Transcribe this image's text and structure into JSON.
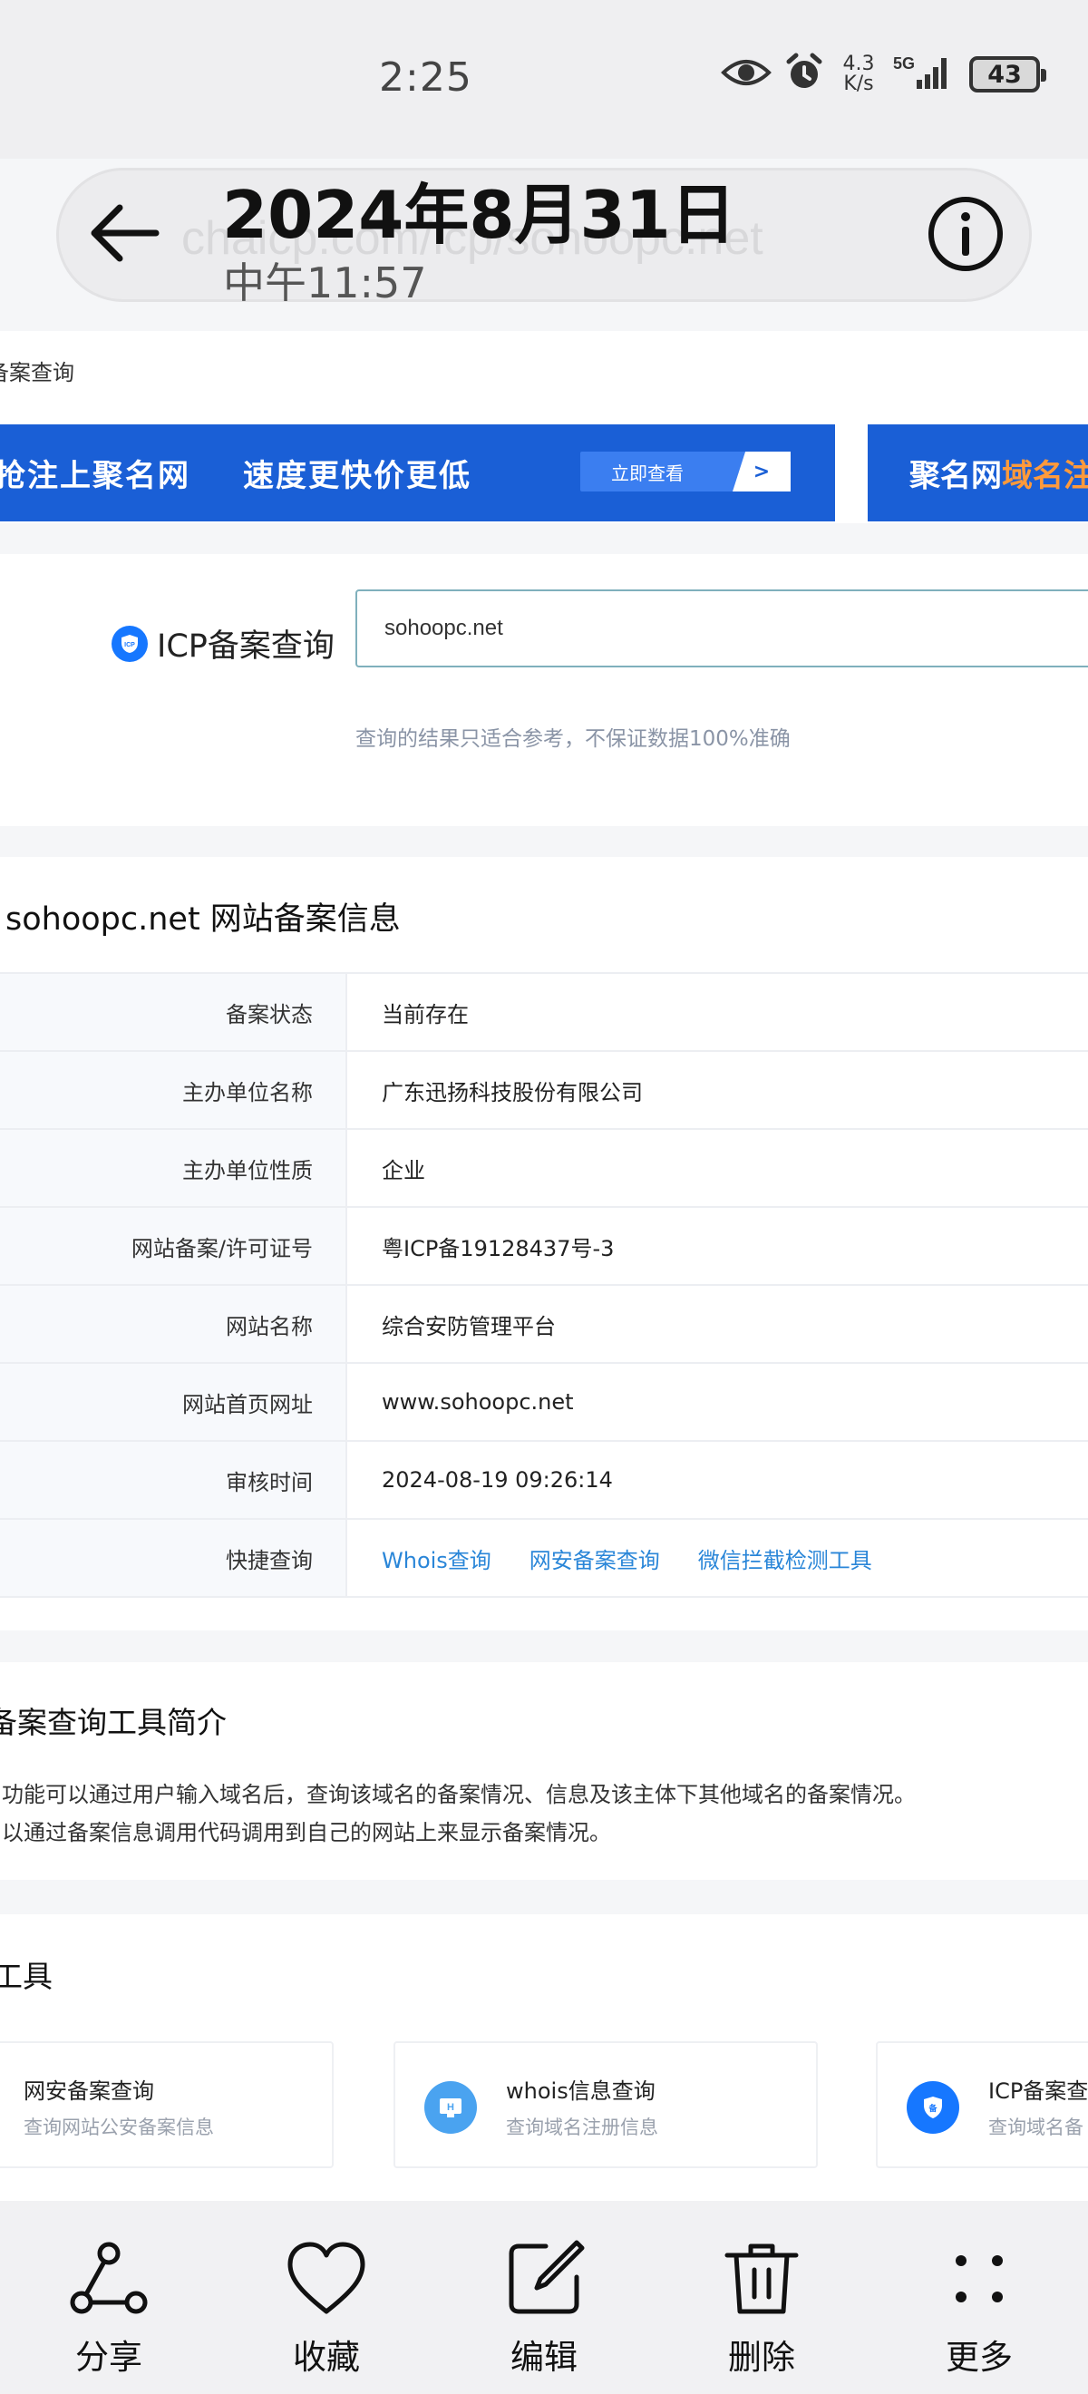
{
  "status_bar": {
    "time": "2:25",
    "net_speed_top": "4.3",
    "net_speed_bottom": "K/s",
    "signal_label": "5G",
    "battery": "43"
  },
  "overlay": {
    "date": "2024年8月31日",
    "time": "中午11:57"
  },
  "address_bar": {
    "url": "chaicp.com/icp/sohoopc.net"
  },
  "page": {
    "breadcrumb": "备案查询",
    "banner_1": {
      "text_a": "抢注上聚名网",
      "text_b": "速度更快价更低",
      "button": "立即查看",
      "button_arrow": ">"
    },
    "banner_2": {
      "text_a": "聚名网",
      "text_b": "域名注"
    },
    "search": {
      "label": "ICP备案查询",
      "value": "sohoopc.net",
      "note": "查询的结果只适合参考，不保证数据100%准确"
    },
    "info": {
      "title": "sohoopc.net 网站备案信息",
      "rows": [
        {
          "key": "备案状态",
          "value": "当前存在"
        },
        {
          "key": "主办单位名称",
          "value": "广东迅扬科技股份有限公司"
        },
        {
          "key": "主办单位性质",
          "value": "企业"
        },
        {
          "key": "网站备案/许可证号",
          "value": "粤ICP备19128437号-3"
        },
        {
          "key": "网站名称",
          "value": "综合安防管理平台"
        },
        {
          "key": "网站首页网址",
          "value": "www.sohoopc.net"
        },
        {
          "key": "审核时间",
          "value": "2024-08-19 09:26:14"
        }
      ],
      "quick_key": "快捷查询",
      "quick_links": [
        "Whois查询",
        "网安备案查询",
        "微信拦截检测工具"
      ]
    },
    "intro": {
      "title": "备案查询工具简介",
      "line1": "功能可以通过用户输入域名后，查询该域名的备案情况、信息及该主体下其他域名的备案情况。",
      "line2": "以通过备案信息调用代码调用到自己的网站上来显示备案情况。"
    },
    "tools": {
      "title": "工具",
      "items": [
        {
          "name": "网安备案查询",
          "desc": "查询网站公安备案信息"
        },
        {
          "name": "whois信息查询",
          "desc": "查询域名注册信息"
        },
        {
          "name": "ICP备案查",
          "desc": "查询域名备"
        }
      ]
    }
  },
  "bottom_bar": {
    "share": "分享",
    "favorite": "收藏",
    "edit": "编辑",
    "delete": "删除",
    "more": "更多"
  },
  "colors": {
    "banner_blue": "#1a5fd6",
    "link_blue": "#2a86d8",
    "banner_highlight": "#ff9a3b"
  }
}
